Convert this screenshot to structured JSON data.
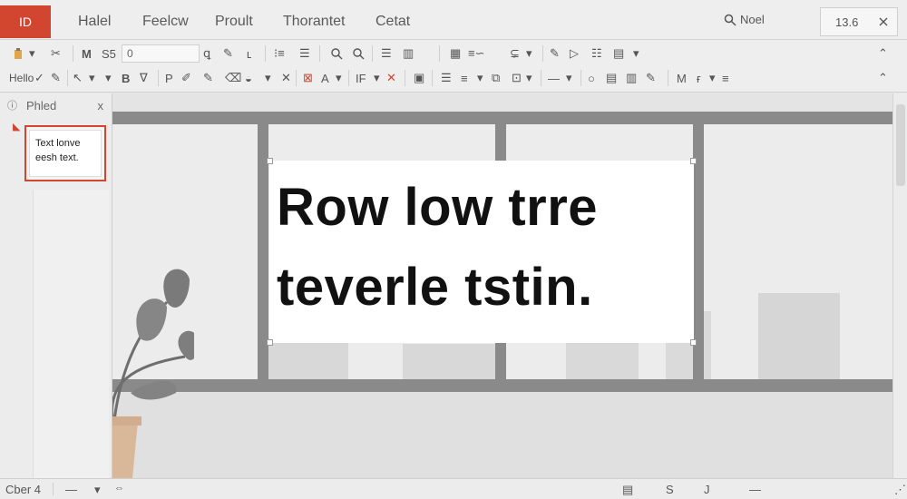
{
  "app": {
    "badge": "ID"
  },
  "tabs": [
    "Halel",
    "Feelcw",
    "Proult",
    "Thorantet",
    "Cetat"
  ],
  "search": {
    "label": "Noel"
  },
  "zoom": {
    "value": "13.6"
  },
  "ribbon": {
    "font_box": "0",
    "row1_text": [
      "M",
      "S5"
    ],
    "row2_text": [
      "Hello",
      "B",
      "P",
      "IF",
      "M"
    ]
  },
  "pane": {
    "title": "Phled",
    "close": "x",
    "thumb_line1": "Text lonve",
    "thumb_line2": "eesh text."
  },
  "slide": {
    "line1": "Row low trre",
    "line2": "teverle tstin."
  },
  "status": {
    "slide_label": "Cber 4",
    "center_text": "S",
    "right_text": "J"
  }
}
